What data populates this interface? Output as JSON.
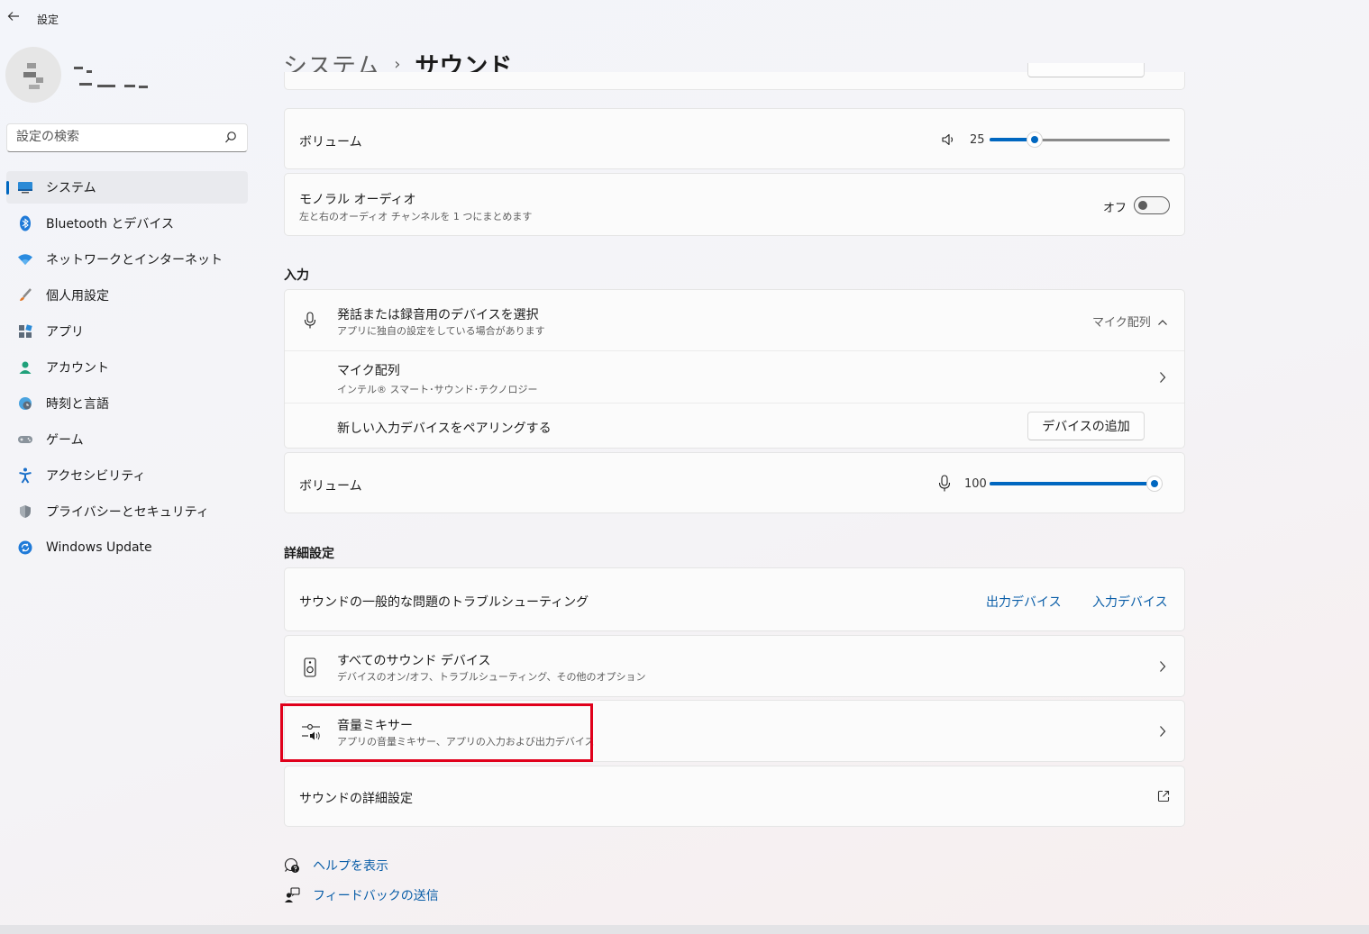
{
  "window": {
    "app_title": "設定"
  },
  "sidebar": {
    "search_placeholder": "設定の検索",
    "items": [
      {
        "label": "システム",
        "icon": "monitor-icon"
      },
      {
        "label": "Bluetooth とデバイス",
        "icon": "bluetooth-icon"
      },
      {
        "label": "ネットワークとインターネット",
        "icon": "wifi-icon"
      },
      {
        "label": "個人用設定",
        "icon": "brush-icon"
      },
      {
        "label": "アプリ",
        "icon": "apps-icon"
      },
      {
        "label": "アカウント",
        "icon": "person-icon"
      },
      {
        "label": "時刻と言語",
        "icon": "globe-clock-icon"
      },
      {
        "label": "ゲーム",
        "icon": "gamepad-icon"
      },
      {
        "label": "アクセシビリティ",
        "icon": "accessibility-icon"
      },
      {
        "label": "プライバシーとセキュリティ",
        "icon": "shield-icon"
      },
      {
        "label": "Windows Update",
        "icon": "update-icon"
      }
    ],
    "active_index": 0
  },
  "breadcrumb": {
    "parent": "システム",
    "separator": "›",
    "current": "サウンド"
  },
  "output": {
    "volume_label": "ボリューム",
    "volume_value": "25",
    "volume_level": 25,
    "mono_title": "モノラル オーディオ",
    "mono_desc": "左と右のオーディオ チャンネルを 1 つにまとめます",
    "mono_state": "オフ"
  },
  "input": {
    "section_title": "入力",
    "device_select_title": "発話または録音用のデバイスを選択",
    "device_select_desc": "アプリに独自の設定をしている場合があります",
    "selected_device": "マイク配列",
    "device_name": "マイク配列",
    "device_desc": "インテル® スマート･サウンド･テクノロジー",
    "pair_label": "新しい入力デバイスをペアリングする",
    "add_device_button": "デバイスの追加",
    "volume_label": "ボリューム",
    "volume_value": "100",
    "volume_level": 100
  },
  "advanced": {
    "section_title": "詳細設定",
    "troubleshoot_label": "サウンドの一般的な問題のトラブルシューティング",
    "output_device_link": "出力デバイス",
    "input_device_link": "入力デバイス",
    "all_devices_title": "すべてのサウンド デバイス",
    "all_devices_desc": "デバイスのオン/オフ、トラブルシューティング、その他のオプション",
    "mixer_title": "音量ミキサー",
    "mixer_desc": "アプリの音量ミキサー、アプリの入力および出力デバイス",
    "more_settings_label": "サウンドの詳細設定"
  },
  "footer": {
    "help_label": "ヘルプを表示",
    "feedback_label": "フィードバックの送信"
  },
  "colors": {
    "accent": "#0067c0",
    "highlight": "#e0001b",
    "link": "#0a5ea8"
  }
}
